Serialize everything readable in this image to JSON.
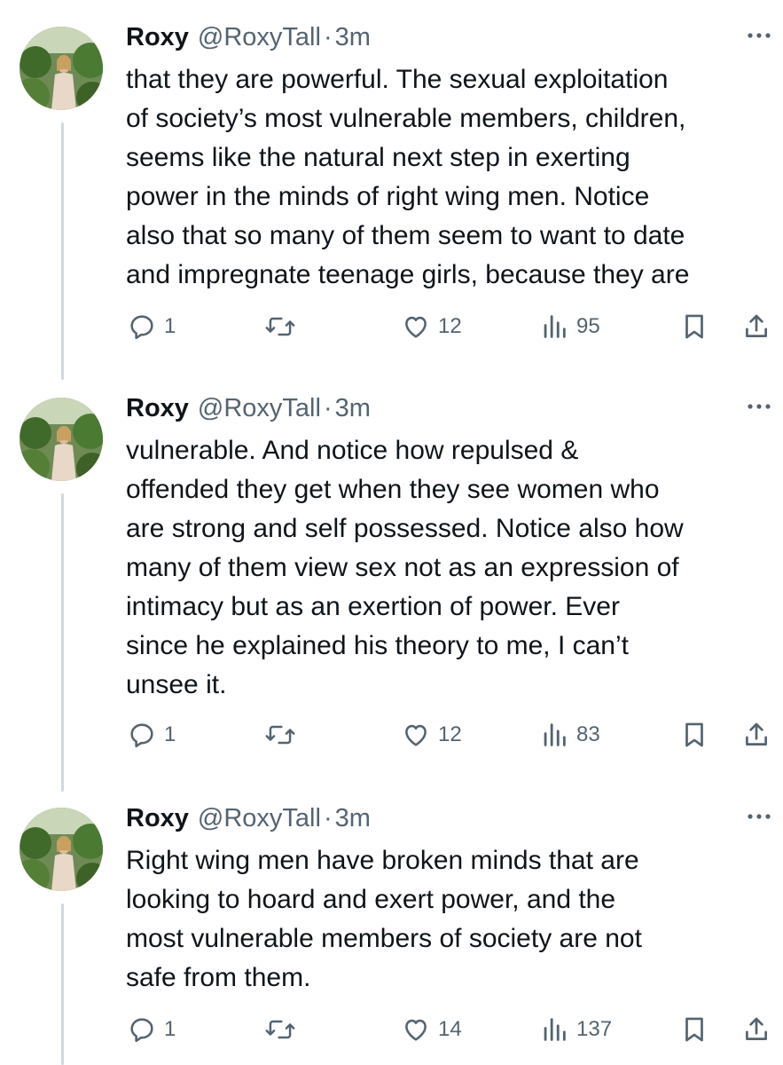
{
  "tweets": [
    {
      "name": "Roxy",
      "handle": "@RoxyTall",
      "separator": "·",
      "time": "3m",
      "lines": [
        "that they are powerful. The sexual exploitation",
        "of society’s most vulnerable members, children,",
        "seems like the natural next step in exerting",
        "power in the minds of right wing men. Notice",
        "also that so many of them seem to want to date",
        "and impregnate teenage girls, because they are"
      ],
      "replies": "1",
      "likes": "12",
      "views": "95"
    },
    {
      "name": "Roxy",
      "handle": "@RoxyTall",
      "separator": "·",
      "time": "3m",
      "lines": [
        "vulnerable. And notice how repulsed &",
        "offended they get when they see women who",
        "are strong and self possessed. Notice also how",
        "many of them view sex not as an expression of",
        "intimacy but as an exertion of power. Ever",
        "since he explained his theory to me, I can’t",
        "unsee it."
      ],
      "replies": "1",
      "likes": "12",
      "views": "83"
    },
    {
      "name": "Roxy",
      "handle": "@RoxyTall",
      "separator": "·",
      "time": "3m",
      "lines": [
        "Right wing men have broken minds that are",
        "looking to hoard and exert power, and the",
        "most vulnerable members of society are not",
        "safe from them."
      ],
      "replies": "1",
      "likes": "14",
      "views": "137"
    }
  ],
  "icons": {
    "more": "more-horizontal-icon",
    "reply": "reply-icon",
    "retweet": "retweet-icon",
    "like": "heart-icon",
    "views": "views-chart-icon",
    "bookmark": "bookmark-icon",
    "share": "share-icon"
  },
  "colors": {
    "text": "#0f1419",
    "secondary": "#536471",
    "thread_line": "#cfd9de",
    "background": "#ffffff"
  }
}
